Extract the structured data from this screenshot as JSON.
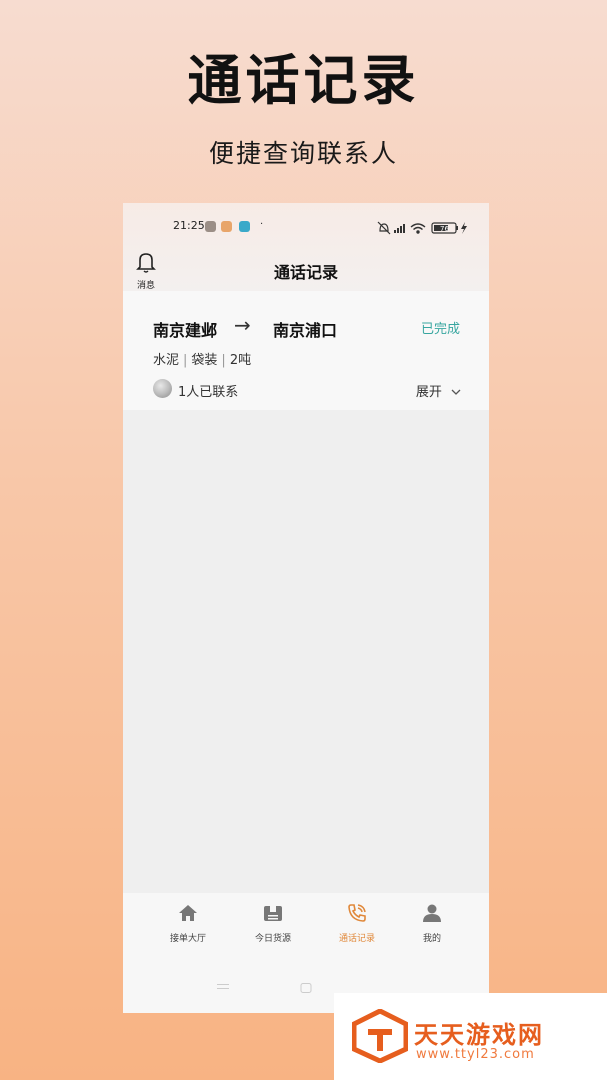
{
  "promo": {
    "headline": "通话记录",
    "subline": "便捷查询联系人"
  },
  "statusbar": {
    "time": "21:25",
    "dot": "·",
    "battery": "76",
    "icons": [
      "mute-icon",
      "signal-icon",
      "wifi-icon",
      "battery-icon",
      "charging-icon"
    ]
  },
  "header": {
    "messages_label": "消息",
    "title": "通话记录"
  },
  "record": {
    "from": "南京建邺",
    "arrow": "→",
    "to": "南京浦口",
    "status": "已完成",
    "goods": "水泥",
    "packaging": "袋装",
    "weight": "2吨",
    "contacted": "1人已联系",
    "expand_label": "展开"
  },
  "tabbar": {
    "tabs": [
      {
        "label": "接单大厅",
        "icon": "home-icon",
        "active": false
      },
      {
        "label": "今日货源",
        "icon": "cargo-box-icon",
        "active": false
      },
      {
        "label": "通话记录",
        "icon": "phone-call-icon",
        "active": true
      },
      {
        "label": "我的",
        "icon": "user-icon",
        "active": false
      }
    ]
  },
  "watermark": {
    "name": "天天游戏网",
    "url": "www.ttyl23.com"
  },
  "colors": {
    "accent": "#e0883a",
    "status_done": "#38a6a0",
    "watermark": "#e65e1e"
  }
}
